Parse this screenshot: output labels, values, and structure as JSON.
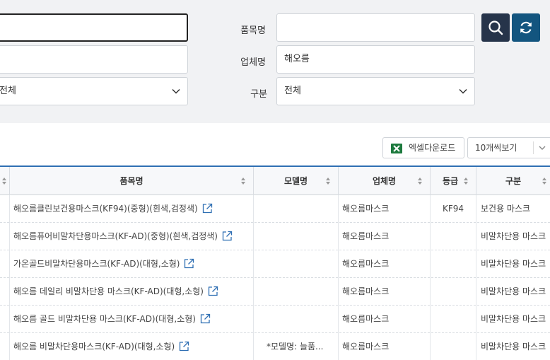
{
  "search": {
    "item_name_label": "품목명",
    "item_name_value": "",
    "company_label": "업체명",
    "company_value": "해오름",
    "category_label": "구분",
    "category_value": "전체",
    "left_select_value": "전체"
  },
  "toolbar": {
    "excel_label": "엑셀다운로드",
    "page_size_label": "10개씩보기"
  },
  "table": {
    "headers": {
      "item_name": "품목명",
      "model": "모델명",
      "company": "업체명",
      "grade": "등급",
      "category": "구분"
    },
    "rows": [
      {
        "item_name": "해오름클린보건용마스크(KF94)(중형)(흰색,검정색)",
        "model": "",
        "company": "해오름마스크",
        "grade": "KF94",
        "category": "보건용 마스크"
      },
      {
        "item_name": "해오름퓨어비말차단용마스크(KF-AD)(중형)(흰색,검정색)",
        "model": "",
        "company": "해오름마스크",
        "grade": "",
        "category": "비말차단용 마스크"
      },
      {
        "item_name": "가온골드비말차단용마스크(KF-AD)(대형,소형)",
        "model": "",
        "company": "해오름마스크",
        "grade": "",
        "category": "비말차단용 마스크"
      },
      {
        "item_name": "해오름 데일리 비말차단용 마스크(KF-AD)(대형,소형)",
        "model": "",
        "company": "해오름마스크",
        "grade": "",
        "category": "비말차단용 마스크"
      },
      {
        "item_name": "해오름 골드 비말차단용 마스크(KF-AD)(대형,소형)",
        "model": "",
        "company": "해오름마스크",
        "grade": "",
        "category": "비말차단용 마스크"
      },
      {
        "item_name": "해오름 비말차단용마스크(KF-AD)(대형,소형)",
        "model": "*모델명: 늘품...",
        "company": "해오름마스크",
        "grade": "",
        "category": "비말차단용 마스크"
      }
    ]
  },
  "colors": {
    "search_button": "#26344a",
    "reset_button": "#13557f",
    "table_top_border": "#2f6fb3",
    "excel_icon": "#1d7a3e"
  },
  "icons": [
    "search-icon",
    "refresh-icon",
    "chevron-down-icon",
    "excel-icon",
    "external-link-icon",
    "sort-icon"
  ]
}
